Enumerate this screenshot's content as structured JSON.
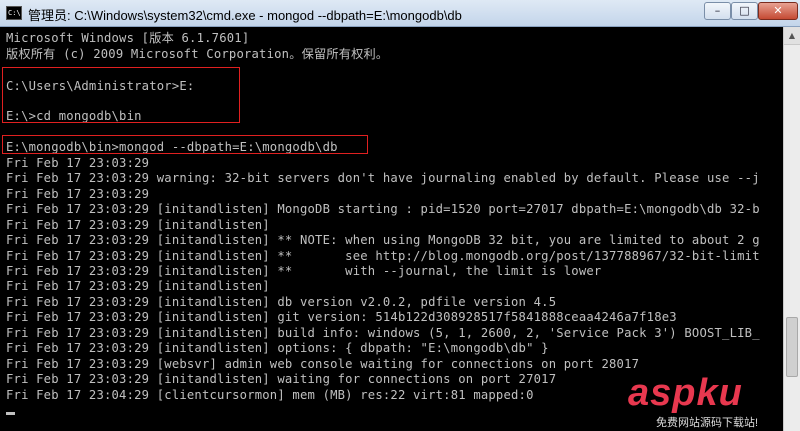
{
  "window": {
    "title": "管理员: C:\\Windows\\system32\\cmd.exe - mongod  --dbpath=E:\\mongodb\\db",
    "icon_label": "C:\\",
    "minimize_icon": "minimize-icon",
    "maximize_icon": "maximize-icon",
    "close_icon": "close-icon"
  },
  "console": {
    "lines": [
      "Microsoft Windows [版本 6.1.7601]",
      "版权所有 (c) 2009 Microsoft Corporation。保留所有权利。",
      "",
      "C:\\Users\\Administrator>E:",
      "",
      "E:\\>cd mongodb\\bin",
      "",
      "E:\\mongodb\\bin>mongod --dbpath=E:\\mongodb\\db",
      "Fri Feb 17 23:03:29",
      "Fri Feb 17 23:03:29 warning: 32-bit servers don't have journaling enabled by default. Please use --j",
      "Fri Feb 17 23:03:29",
      "Fri Feb 17 23:03:29 [initandlisten] MongoDB starting : pid=1520 port=27017 dbpath=E:\\mongodb\\db 32-b",
      "Fri Feb 17 23:03:29 [initandlisten]",
      "Fri Feb 17 23:03:29 [initandlisten] ** NOTE: when using MongoDB 32 bit, you are limited to about 2 g",
      "Fri Feb 17 23:03:29 [initandlisten] **       see http://blog.mongodb.org/post/137788967/32-bit-limit",
      "Fri Feb 17 23:03:29 [initandlisten] **       with --journal, the limit is lower",
      "Fri Feb 17 23:03:29 [initandlisten]",
      "Fri Feb 17 23:03:29 [initandlisten] db version v2.0.2, pdfile version 4.5",
      "Fri Feb 17 23:03:29 [initandlisten] git version: 514b122d308928517f5841888ceaa4246a7f18e3",
      "Fri Feb 17 23:03:29 [initandlisten] build info: windows (5, 1, 2600, 2, 'Service Pack 3') BOOST_LIB_",
      "Fri Feb 17 23:03:29 [initandlisten] options: { dbpath: \"E:\\mongodb\\db\" }",
      "Fri Feb 17 23:03:29 [websvr] admin web console waiting for connections on port 28017",
      "Fri Feb 17 23:03:29 [initandlisten] waiting for connections on port 27017",
      "Fri Feb 17 23:04:29 [clientcursormon] mem (MB) res:22 virt:81 mapped:0"
    ]
  },
  "watermark": {
    "logo": "aspku",
    "subtitle": "免费网站源码下载站!"
  }
}
